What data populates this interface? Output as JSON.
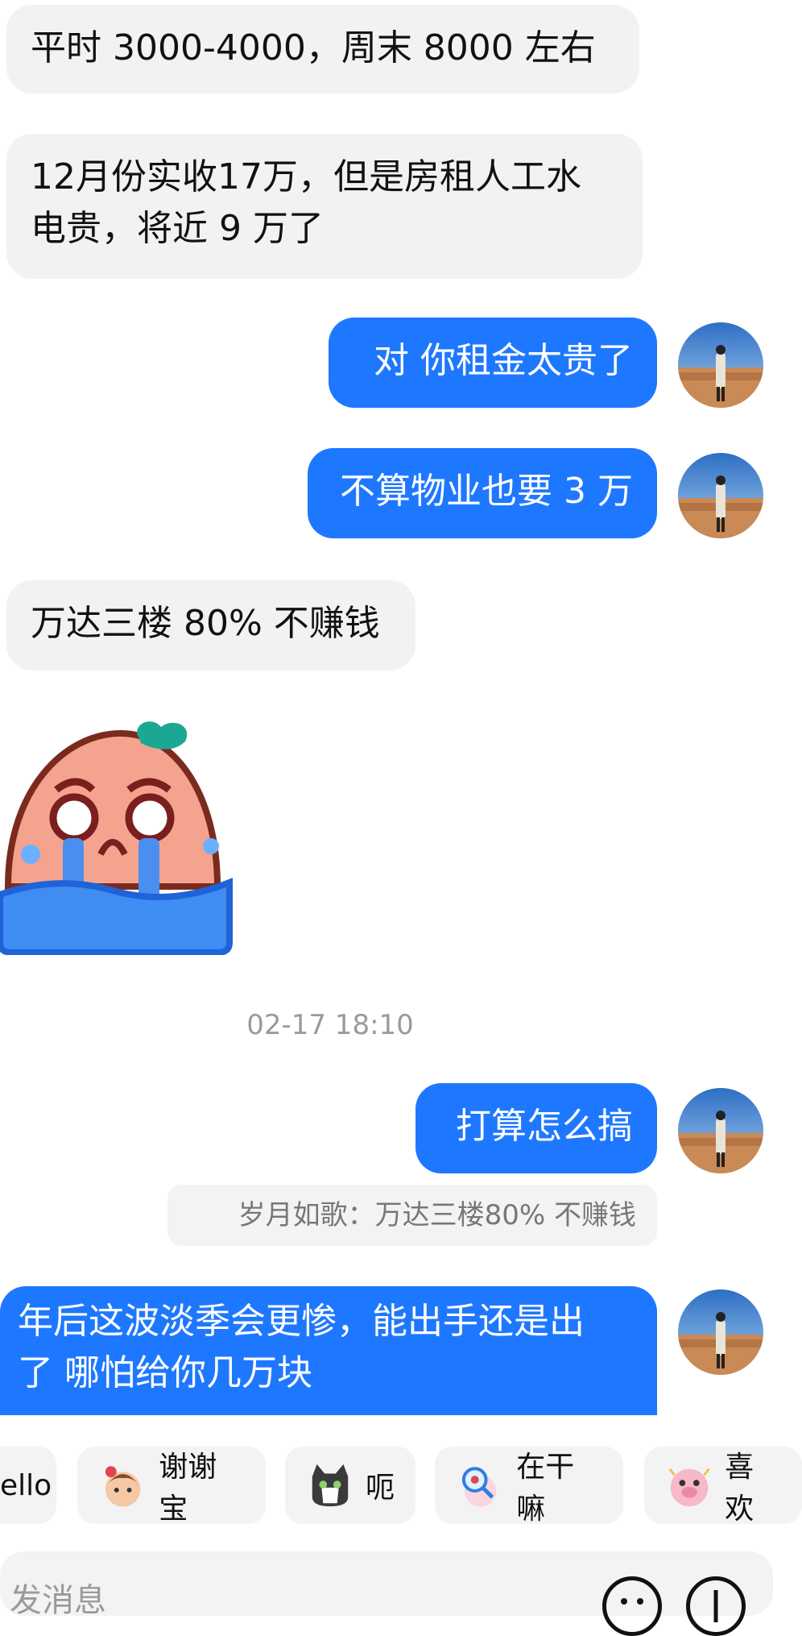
{
  "messages": {
    "m1": "平时 3000-4000，周末 8000 左右",
    "m2_line1": "12月份实收17万，但是房租人工水",
    "m2_line2": "电贵，将近 9 万了",
    "m3": "对 你租金太贵了",
    "m4": "不算物业也要 3 万",
    "m5": "万达三楼 80% 不赚钱",
    "timestamp": "02-17 18:10",
    "m6": "打算怎么搞",
    "quote": "岁月如歌：万达三楼80% 不赚钱",
    "m7_line1": "年后这波淡季会更惨，能出手还是出",
    "m7_line2": "了 哪怕给你几万块"
  },
  "quick_replies": [
    "ello",
    "谢谢宝",
    "呃",
    "在干嘛",
    "喜欢"
  ],
  "input": {
    "placeholder": "发消息"
  },
  "colors": {
    "outgoing_bubble": "#1e78ff",
    "incoming_bubble": "#f2f2f2",
    "timestamp_text": "#9a9a9a"
  }
}
